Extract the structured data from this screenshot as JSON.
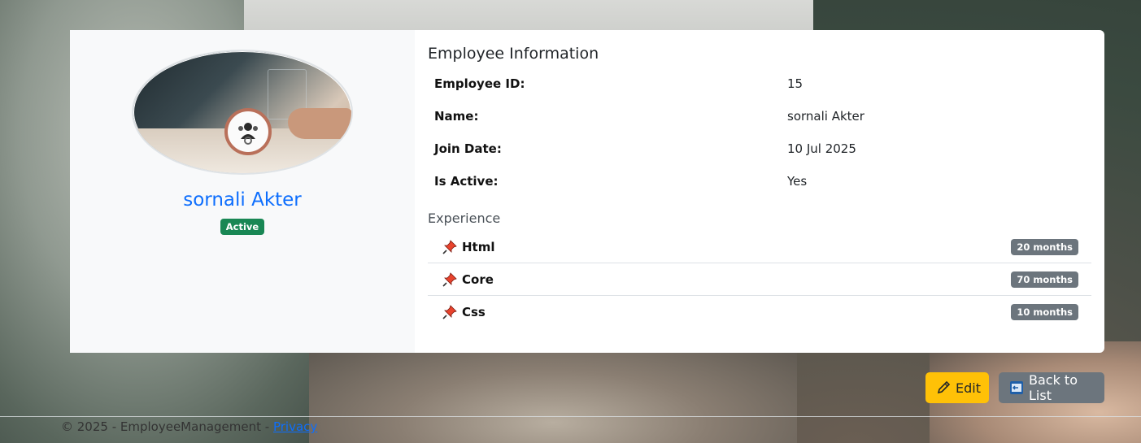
{
  "profile": {
    "name": "sornali Akter",
    "status_badge": "Active"
  },
  "info": {
    "title": "Employee Information",
    "rows": [
      {
        "label": "Employee ID:",
        "value": "15"
      },
      {
        "label": "Name:",
        "value": "sornali Akter"
      },
      {
        "label": "Join Date:",
        "value": "10 Jul 2025"
      },
      {
        "label": "Is Active:",
        "value": "Yes"
      }
    ]
  },
  "experience": {
    "title": "Experience",
    "items": [
      {
        "name": "Html",
        "duration": "20 months"
      },
      {
        "name": "Core",
        "duration": "70 months"
      },
      {
        "name": "Css",
        "duration": "10 months"
      }
    ]
  },
  "actions": {
    "edit_label": "Edit",
    "back_label": "Back to List"
  },
  "footer": {
    "copyright": "© 2025 - EmployeeManagement - ",
    "privacy_link": "Privacy"
  },
  "colors": {
    "accent": "#0d6efd",
    "success": "#198754",
    "warning": "#ffc107",
    "secondary": "#6c757d"
  },
  "icons": {
    "pin": "pushpin-icon",
    "edit": "pencil-icon",
    "back": "back-icon",
    "avatar": "employee-photo"
  }
}
